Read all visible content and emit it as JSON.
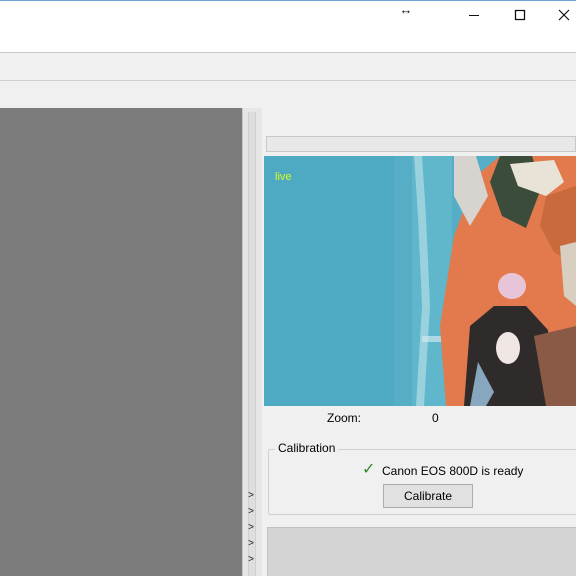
{
  "window": {
    "resize_icon": "↔",
    "controls": [
      "minimize-icon",
      "maximize-icon",
      "close-icon"
    ]
  },
  "live_view": {
    "label": "live"
  },
  "progress": {
    "fraction": 0
  },
  "zoom": {
    "label": "Zoom:",
    "value": "0"
  },
  "calibration": {
    "legend": "Calibration",
    "check_icon": "✓",
    "status": "Canon EOS 800D is ready",
    "button_label": "Calibrate"
  },
  "splitter": {
    "chevron": ">",
    "chevron_count": 5
  },
  "colors": {
    "left_panel": "#7c7c7c",
    "live_view_bg": "#55adc6",
    "live_label": "#d6ff1e",
    "check": "#2e8b2e"
  }
}
